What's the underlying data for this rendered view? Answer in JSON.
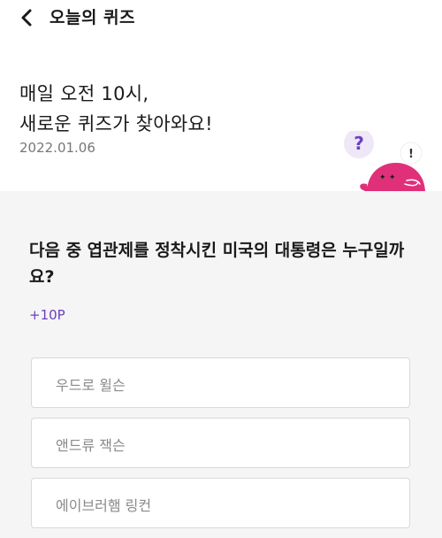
{
  "header": {
    "title": "오늘의 퀴즈",
    "back_icon": "chevron-left-icon"
  },
  "intro": {
    "line1": "매일 오전 10시,",
    "line2": "새로운 퀴즈가 찾아와요!",
    "date": "2022.01.06",
    "mascot": {
      "question_mark": "?",
      "exclamation_mark": "!",
      "colors": {
        "body": "#e0307a",
        "bubble": "#ede7f7",
        "question": "#6a3fc4"
      }
    }
  },
  "quiz": {
    "question": "다음 중 엽관제를 정착시킨 미국의 대통령은 누구일까요?",
    "points": "+10P",
    "options": [
      {
        "label": "우드로 윌슨"
      },
      {
        "label": "앤드류 잭슨"
      },
      {
        "label": "에이브러햄 링컨"
      }
    ]
  },
  "colors": {
    "background": "#ffffff",
    "quiz_background": "#f5f5f5",
    "accent": "#6a3fc4",
    "text": "#1a1a1a",
    "muted_text": "#777777"
  }
}
